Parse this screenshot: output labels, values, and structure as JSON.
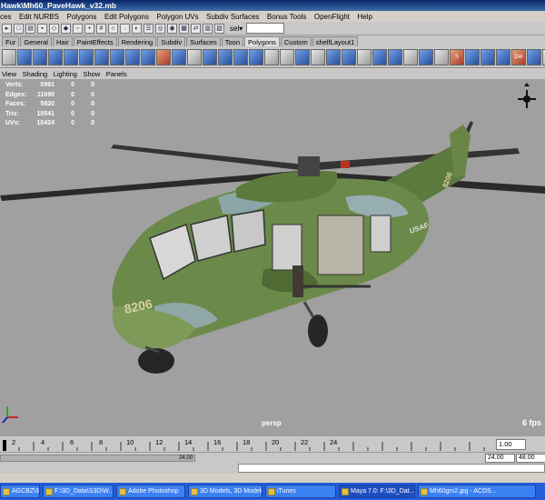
{
  "window": {
    "title": "Hawk\\Mh60_PaveHawk_v32.mb"
  },
  "menubar": {
    "items": [
      "ces",
      "Edit NURBS",
      "Polygons",
      "Edit Polygons",
      "Polygon UVs",
      "Subdiv Surfaces",
      "Bonus Tools",
      "OpenFlight",
      "Help"
    ]
  },
  "statusline": {
    "select_label": "sel▾",
    "select_value": ""
  },
  "shelf_tabs": [
    "Fur",
    "General",
    "Hair",
    "PaintEffects",
    "Rendering",
    "Subdiv",
    "Surfaces",
    "Toon",
    "Polygons",
    "Custom",
    "shelfLayout1"
  ],
  "shelf_active_tab": "Polygons",
  "shelf_text": {
    "smap": "S Map",
    "delete": "Del E"
  },
  "panel_menu": [
    "View",
    "Shading",
    "Lighting",
    "Show",
    "Panels"
  ],
  "hud": [
    {
      "label": "Verts:",
      "value": "5991",
      "a": "0",
      "b": "0"
    },
    {
      "label": "Edges:",
      "value": "11690",
      "a": "0",
      "b": "0"
    },
    {
      "label": "Faces:",
      "value": "5820",
      "a": "0",
      "b": "0"
    },
    {
      "label": "Tris:",
      "value": "10541",
      "a": "0",
      "b": "0"
    },
    {
      "label": "UVs:",
      "value": "10424",
      "a": "0",
      "b": "0"
    }
  ],
  "viewport": {
    "camera_label": "persp",
    "fps": "6 fps",
    "heli_markings": {
      "nose_number": "8206",
      "tail_number": "8206",
      "usaf": "USAF"
    }
  },
  "timeslider": {
    "ticks": [
      "2",
      "4",
      "6",
      "8",
      "10",
      "12",
      "14",
      "16",
      "18",
      "20",
      "22",
      "24"
    ],
    "current_frame": "1.00"
  },
  "rangeslider": {
    "range_label": "24.00",
    "start": "24.00",
    "end": "48.00"
  },
  "taskbar": {
    "items": [
      "AGCBZ\\3d",
      "F:\\3D_Data\\S3D\\W...",
      "Adobe Photoshop",
      "3D Models, 3D Modeli...",
      "iTunes",
      "Maya 7.0: F:\\3D_Dat...",
      "Mh60gm2.jpg - ACDS..."
    ]
  },
  "colors": {
    "viewport_bg": "#a0a0a0",
    "taskbar": "#245edb",
    "title_bar": "#0a246a"
  }
}
